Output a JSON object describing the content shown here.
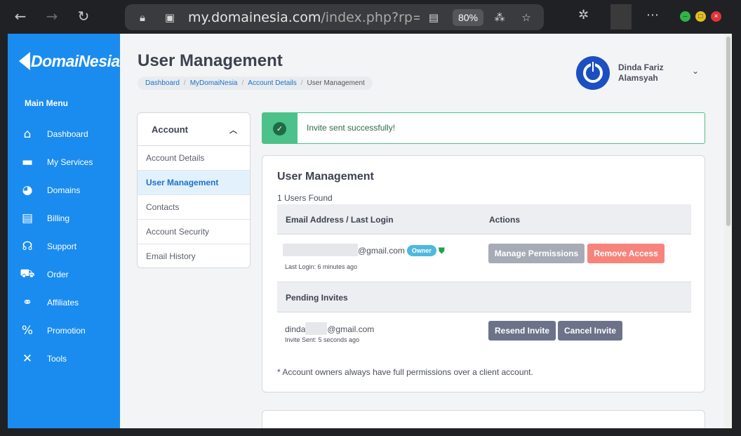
{
  "browser": {
    "url_host": "my.domainesia.com",
    "url_path": "/index.php?rp=/accoun",
    "zoom": "80%"
  },
  "sidebar": {
    "logo": "DomaiNesia",
    "menu_title": "Main Menu",
    "items": [
      {
        "label": "Dashboard",
        "icon": "home-icon",
        "glyph": "⌂"
      },
      {
        "label": "My Services",
        "icon": "server-icon",
        "glyph": "▬"
      },
      {
        "label": "Domains",
        "icon": "globe-icon",
        "glyph": "◕"
      },
      {
        "label": "Billing",
        "icon": "receipt-icon",
        "glyph": "▤"
      },
      {
        "label": "Support",
        "icon": "headset-icon",
        "glyph": "☊"
      },
      {
        "label": "Order",
        "icon": "cart-icon",
        "glyph": "⛟"
      },
      {
        "label": "Affiliates",
        "icon": "handshake-icon",
        "glyph": "⚭"
      },
      {
        "label": "Promotion",
        "icon": "percent-icon",
        "glyph": "%"
      },
      {
        "label": "Tools",
        "icon": "tools-icon",
        "glyph": "✕"
      }
    ]
  },
  "header": {
    "title": "User Management",
    "breadcrumb": [
      "Dashboard",
      "MyDomaiNesia",
      "Account Details",
      "User Management"
    ],
    "user_first": "Dinda Fariz",
    "user_last": "Alamsyah"
  },
  "account_menu": {
    "title": "Account",
    "items": [
      "Account Details",
      "User Management",
      "Contacts",
      "Account Security",
      "Email History"
    ],
    "active": "User Management"
  },
  "alert": {
    "message": "Invite sent successfully!",
    "color": "#4cc28a"
  },
  "users_card": {
    "title": "User Management",
    "count_text": "1 Users Found",
    "col_email": "Email Address / Last Login",
    "col_actions": "Actions",
    "user": {
      "email_suffix": "@gmail.com",
      "badge": "Owner",
      "last_login": "Last Login: 6 minutes ago",
      "btn_manage": "Manage Permissions",
      "btn_remove": "Remove Access"
    },
    "pending_header": "Pending Invites",
    "invite": {
      "email_prefix": "dinda",
      "email_suffix": "@gmail.com",
      "sent": "Invite Sent: 5 seconds ago",
      "btn_resend": "Resend Invite",
      "btn_cancel": "Cancel Invite"
    },
    "note": "* Account owners always have full permissions over a client account."
  },
  "colors": {
    "brand": "#1a8cf0",
    "btn_gray": "#6c7389",
    "btn_disabled": "#a7abb6",
    "btn_danger": "#f7847c"
  }
}
